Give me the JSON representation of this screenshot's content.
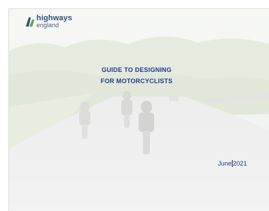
{
  "logo": {
    "line1": "highways",
    "line2": "england",
    "icon": "highways-england-logo-icon"
  },
  "document": {
    "title_line1": "GUIDE TO DESIGNING",
    "title_line2": "FOR MOTORCYCLISTS",
    "date_part1": "June",
    "date_part2": "2021"
  },
  "colors": {
    "title": "#1f3b8f",
    "logo_text": "#2f4f78",
    "logo_accent": "#5aa640"
  }
}
